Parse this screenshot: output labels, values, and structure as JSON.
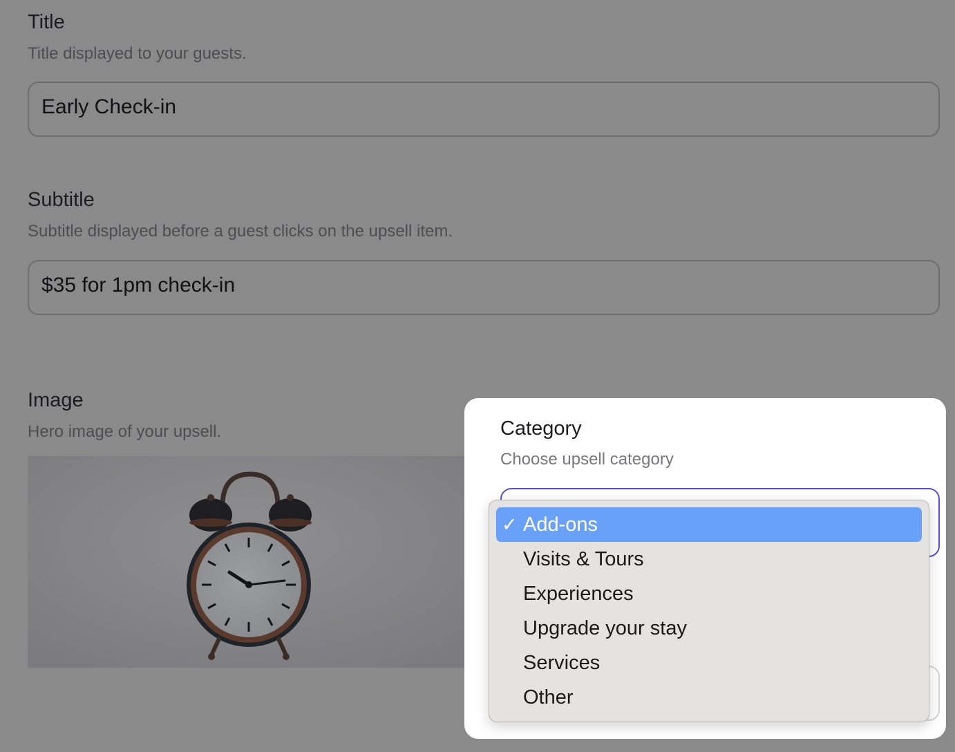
{
  "title_field": {
    "label": "Title",
    "help": "Title displayed to your guests.",
    "value": "Early Check-in"
  },
  "subtitle_field": {
    "label": "Subtitle",
    "help": "Subtitle displayed before a guest clicks on the upsell item.",
    "value": "$35 for 1pm check-in"
  },
  "image_field": {
    "label": "Image",
    "help": "Hero image of your upsell."
  },
  "category_field": {
    "label": "Category",
    "help": "Choose upsell category",
    "check_glyph": "✓",
    "options": [
      "Add-ons",
      "Visits & Tours",
      "Experiences",
      "Upgrade your stay",
      "Services",
      "Other"
    ],
    "selected": "Add-ons"
  },
  "colors": {
    "overlay": "#8a8a8a",
    "focus_border": "#5a4fcf",
    "selected_option": "#6aa1f8",
    "menu_background": "#e5e3e1"
  },
  "icons": {
    "hero_image": "alarm-clock-image",
    "checkmark": "checkmark-icon"
  }
}
